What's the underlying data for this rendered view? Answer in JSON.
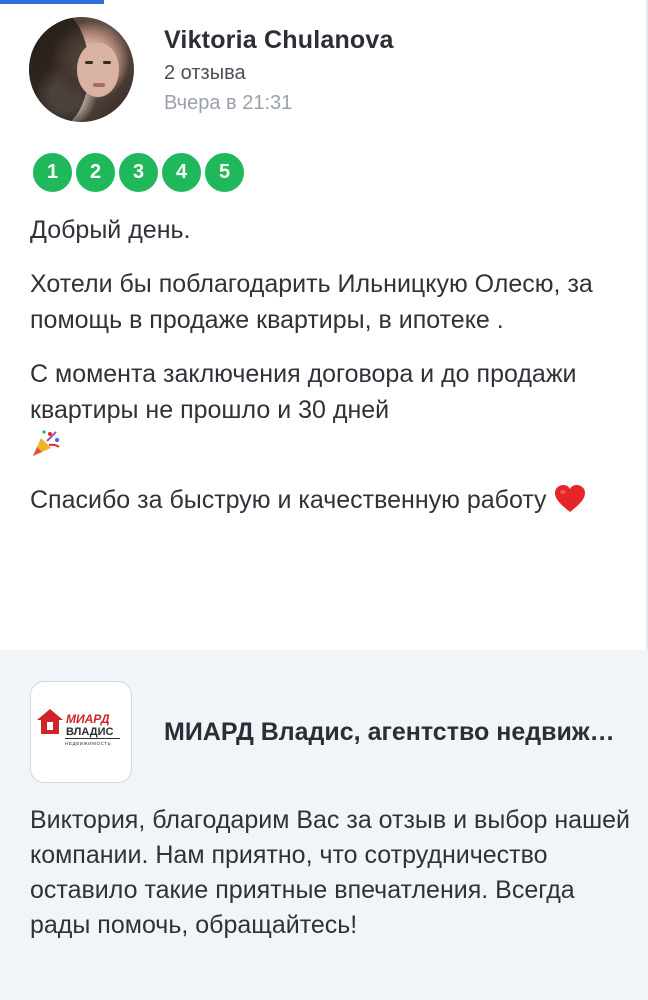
{
  "review": {
    "author_name": "Viktoria Chulanova",
    "review_count": "2 отзыва",
    "date": "Вчера в 21:31",
    "rating": [
      "1",
      "2",
      "3",
      "4",
      "5"
    ],
    "paragraphs": [
      "Добрый день.",
      "Хотели бы поблагодарить Ильницкую Олесю, за помощь в продаже квартиры, в ипотеке .",
      "С момента заключения договора и до продажи квартиры не прошло и 30 дней",
      "Спасибо за быструю и качественную работу"
    ],
    "emojis": [
      "party-popper-icon",
      "red-heart-icon"
    ]
  },
  "reply": {
    "company_name": "МИАРД Владис, агентство недвижимости",
    "logo_text_top": "МИАРД",
    "logo_text_main": "ВЛАДИС",
    "logo_text_sub": "НЕДВИЖИМОСТЬ",
    "text": "Виктория, благодарим Вас за отзыв и выбор нашей компании. Нам приятно, что сотрудничество оставило такие приятные впечатления. Всегда рады помочь, обращайтесь!"
  },
  "colors": {
    "rating_green": "#1fb85a",
    "accent_blue": "#2f6fde",
    "reply_background": "#f1f5fa",
    "heart_red": "#e5252a",
    "logo_red": "#d0242b"
  }
}
